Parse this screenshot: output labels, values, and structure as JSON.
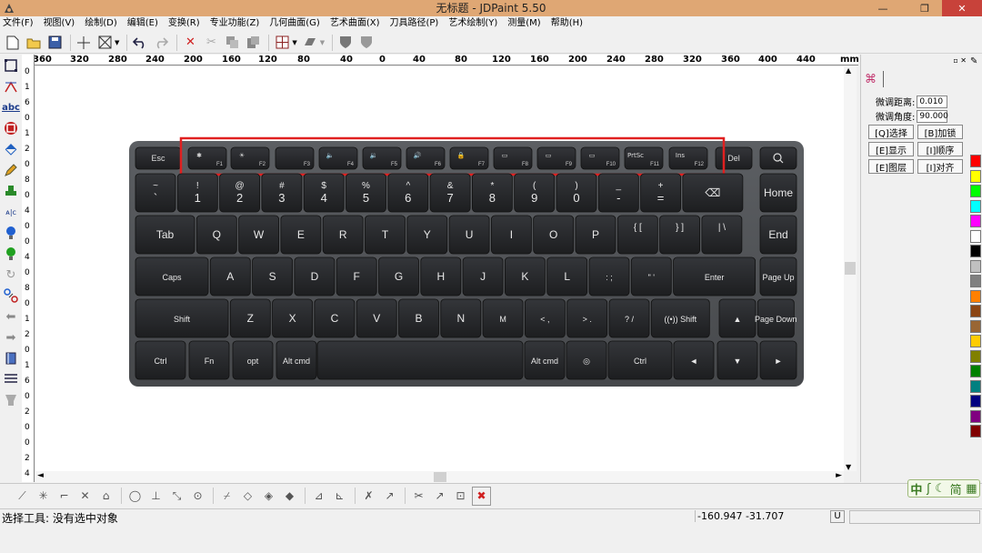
{
  "window": {
    "title": "无标题 - JDPaint 5.50"
  },
  "menu": [
    "文件(F)",
    "视图(V)",
    "绘制(D)",
    "编辑(E)",
    "变换(R)",
    "专业功能(Z)",
    "几何曲面(G)",
    "艺术曲面(X)",
    "刀具路径(P)",
    "艺术绘制(Y)",
    "测量(M)",
    "帮助(H)"
  ],
  "toolbar_icons": [
    "new-file-icon",
    "open-folder-icon",
    "save-icon",
    "crosshair-icon",
    "box-select-icon",
    "undo-icon",
    "redo-icon",
    "delete-icon",
    "cut-icon",
    "copy-icon",
    "paste-icon",
    "grid-icon",
    "shade-icon",
    "shield-icon",
    "shield-outline-icon"
  ],
  "hruler": [
    "00",
    "360",
    "320",
    "280",
    "240",
    "200",
    "160",
    "120",
    "80",
    "40",
    "0",
    "40",
    "80",
    "120",
    "160",
    "200",
    "240",
    "280",
    "320",
    "360",
    "400",
    "440",
    "mm"
  ],
  "vruler": [
    "0",
    "1",
    "6",
    "0",
    "1",
    "2",
    "0",
    "8",
    "0",
    "4",
    "0",
    "0",
    "4",
    "0",
    "8",
    "0",
    "1",
    "2",
    "0",
    "1",
    "6",
    "0",
    "2",
    "0",
    "0",
    "2",
    "4"
  ],
  "panel": {
    "distance_label": "微调距离:",
    "distance_value": "0.010",
    "angle_label": "微调角度:",
    "angle_value": "90.000",
    "buttons": [
      "[Q]选择",
      "[B]加锁",
      "[E]显示",
      "[I]顺序",
      "[E]图层",
      "[I]对齐"
    ]
  },
  "palette": [
    "#ff0000",
    "#ffff00",
    "#00ff00",
    "#00ffff",
    "#ff00ff",
    "#ffffff",
    "#000000",
    "#c0c0c0",
    "#808080",
    "#ff8000",
    "#8b4513",
    "#996633",
    "#ffcc00",
    "#808000",
    "#008000",
    "#008080",
    "#000080",
    "#800080",
    "#800000"
  ],
  "keyboard": {
    "fn_row": [
      "Esc",
      "F1",
      "F2",
      "F3",
      "F4",
      "F5",
      "F6",
      "F7",
      "F8",
      "F9",
      "F10",
      "F11",
      "F12",
      "Del"
    ],
    "fn_top": [
      "",
      "✱",
      "☀",
      "",
      "🔈",
      "🔉",
      "🔊",
      "🔒",
      "▭",
      "▭",
      "▭",
      "PrtSc",
      "Ins",
      ""
    ],
    "num_row": [
      [
        "~",
        "`"
      ],
      [
        "!",
        "1"
      ],
      [
        "@",
        "2"
      ],
      [
        "#",
        "3"
      ],
      [
        "$",
        "4"
      ],
      [
        "%",
        "5"
      ],
      [
        "^",
        "6"
      ],
      [
        "&",
        "7"
      ],
      [
        "*",
        "8"
      ],
      [
        "(",
        "9"
      ],
      [
        ")",
        "0"
      ],
      [
        "_",
        "-"
      ],
      [
        "+",
        "="
      ],
      [
        "",
        "⌫"
      ],
      [
        "",
        "Home"
      ]
    ],
    "row_q": [
      "Tab",
      "Q",
      "W",
      "E",
      "R",
      "T",
      "Y",
      "U",
      "I",
      "O",
      "P",
      "{ [",
      "} ]",
      "| \\",
      "End"
    ],
    "row_a": [
      "Caps",
      "A",
      "S",
      "D",
      "F",
      "G",
      "H",
      "J",
      "K",
      "L",
      ": ;",
      "\" '",
      "Enter",
      "Page Up"
    ],
    "row_z": [
      "Shift",
      "Z",
      "X",
      "C",
      "V",
      "B",
      "N",
      "M",
      "< ,",
      "> .",
      "? /",
      "((•)) Shift",
      "▲",
      "Page Down"
    ],
    "row_b": [
      "Ctrl",
      "Fn",
      "opt",
      "Alt cmd",
      "",
      "Alt cmd",
      "◎",
      "Ctrl",
      "◄",
      "▼",
      "►"
    ]
  },
  "status": {
    "text": "选择工具: 没有选中对象",
    "coords": "-160.947  -31.707",
    "unit": "U"
  },
  "ime": [
    "中",
    "ʃ",
    "☾",
    "简",
    "▦"
  ]
}
